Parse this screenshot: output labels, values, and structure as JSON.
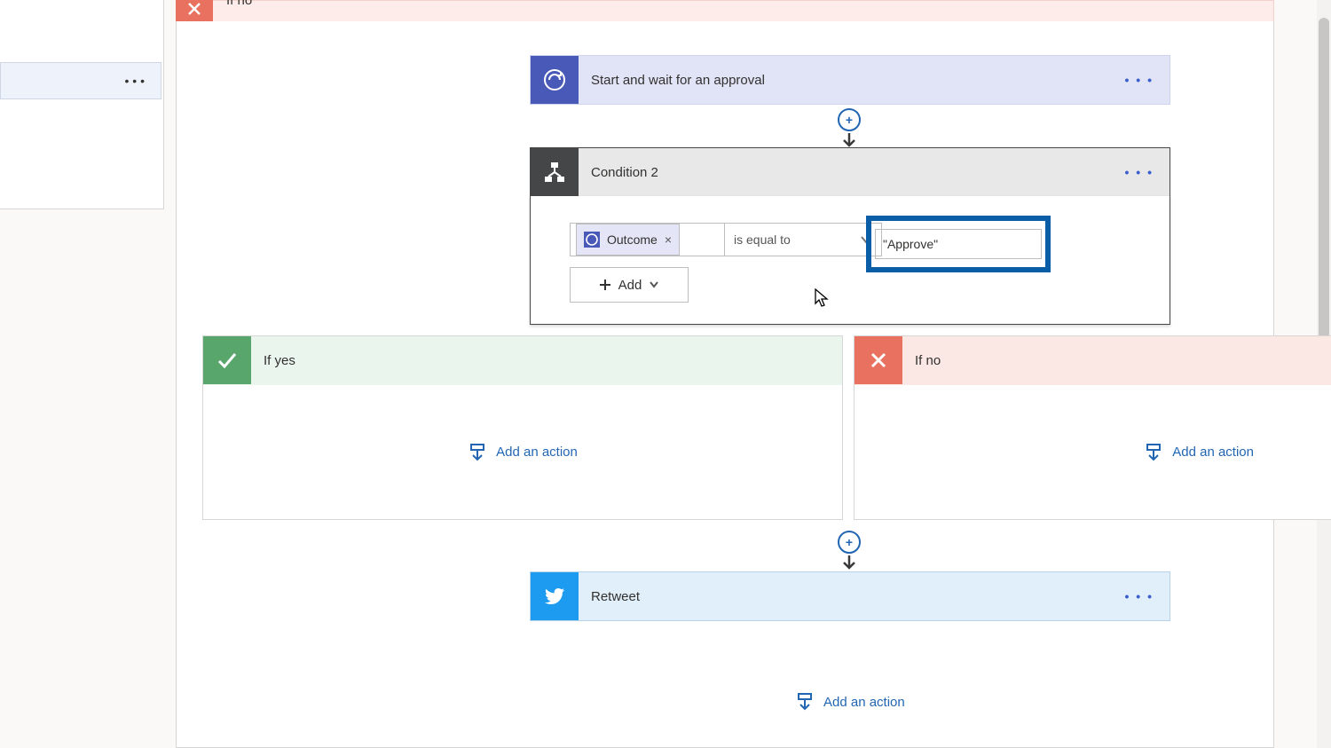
{
  "top_strip": {
    "label": "If no"
  },
  "left_card": {
    "menu": "• • •"
  },
  "approval": {
    "title": "Start and wait for an approval",
    "menu": "• • •"
  },
  "condition": {
    "title": "Condition 2",
    "menu": "• • •",
    "token_label": "Outcome",
    "operator": "is equal to",
    "value": "\"Approve\"",
    "add_label": "Add"
  },
  "branch_yes": {
    "title": "If yes",
    "add_action": "Add an action"
  },
  "branch_no": {
    "title": "If no",
    "add_action": "Add an action"
  },
  "retweet": {
    "title": "Retweet",
    "menu": "• • •"
  },
  "bottom": {
    "add_action": "Add an action"
  }
}
